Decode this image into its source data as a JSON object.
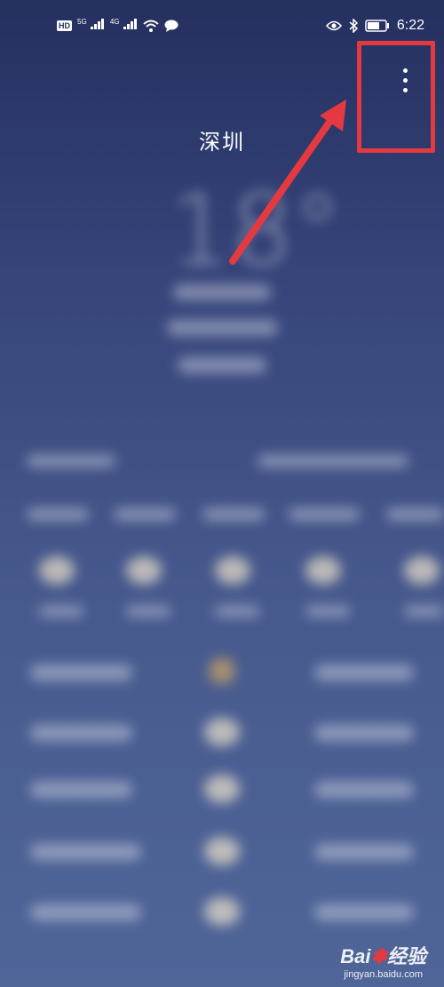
{
  "status_bar": {
    "hd_label": "HD",
    "network_5g": "5G",
    "network_4g": "4G",
    "time": "6:22"
  },
  "weather": {
    "city": "深圳",
    "temperature": "18°"
  },
  "icons": {
    "more": "more-vertical-icon",
    "eye": "eye-icon",
    "bluetooth": "bluetooth-icon",
    "battery": "battery-icon",
    "wifi": "wifi-icon",
    "message": "message-bubble-icon"
  },
  "annotation": {
    "highlight_color": "#e53942"
  },
  "watermark": {
    "logo_left": "Bai",
    "logo_right": "经验",
    "url": "jingyan.baidu.com"
  }
}
